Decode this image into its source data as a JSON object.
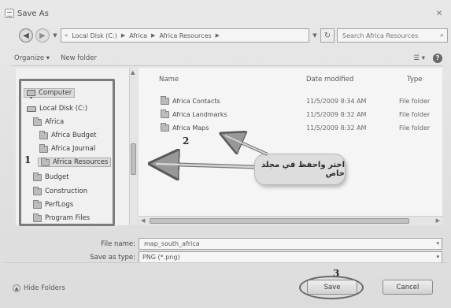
{
  "window": {
    "title": "Save As"
  },
  "address": {
    "segments": [
      "Local Disk (C:)",
      "Africa",
      "Africa Resources"
    ],
    "search_placeholder": "Search Africa Resources"
  },
  "toolbar": {
    "organize": "Organize ▾",
    "new_folder": "New folder"
  },
  "nav_tree": [
    {
      "label": "Computer",
      "icon": "computer-icon"
    },
    {
      "label": "Local Disk (C:)",
      "icon": "drive-icon"
    },
    {
      "label": "Africa",
      "icon": "folder-icon"
    },
    {
      "label": "Africa Budget",
      "icon": "folder-icon"
    },
    {
      "label": "Africa Journal",
      "icon": "folder-icon"
    },
    {
      "label": "Africa Resources",
      "icon": "folder-icon"
    },
    {
      "label": "Budget",
      "icon": "folder-icon"
    },
    {
      "label": "Construction",
      "icon": "folder-icon"
    },
    {
      "label": "PerfLogs",
      "icon": "folder-icon"
    },
    {
      "label": "Program Files",
      "icon": "folder-icon"
    }
  ],
  "file_list": {
    "columns": {
      "name": "Name",
      "date": "Date modified",
      "type": "Type"
    },
    "rows": [
      {
        "name": "Africa Contacts",
        "date": "11/5/2009 8:34 AM",
        "type": "File folder"
      },
      {
        "name": "Africa Landmarks",
        "date": "11/5/2009 8:32 AM",
        "type": "File folder"
      },
      {
        "name": "Africa Maps",
        "date": "11/5/2009 8:32 AM",
        "type": "File folder"
      }
    ]
  },
  "fields": {
    "file_name_label": "File name:",
    "file_name_value": "map_south_africa",
    "save_type_label": "Save as type:",
    "save_type_value": "PNG (*.png)"
  },
  "footer": {
    "hide_folders": "Hide Folders",
    "save": "Save",
    "cancel": "Cancel"
  },
  "annotations": {
    "n1": "1",
    "n2": "2",
    "n3": "3",
    "callout": "اختر واحفظ في مجلد خاص"
  }
}
